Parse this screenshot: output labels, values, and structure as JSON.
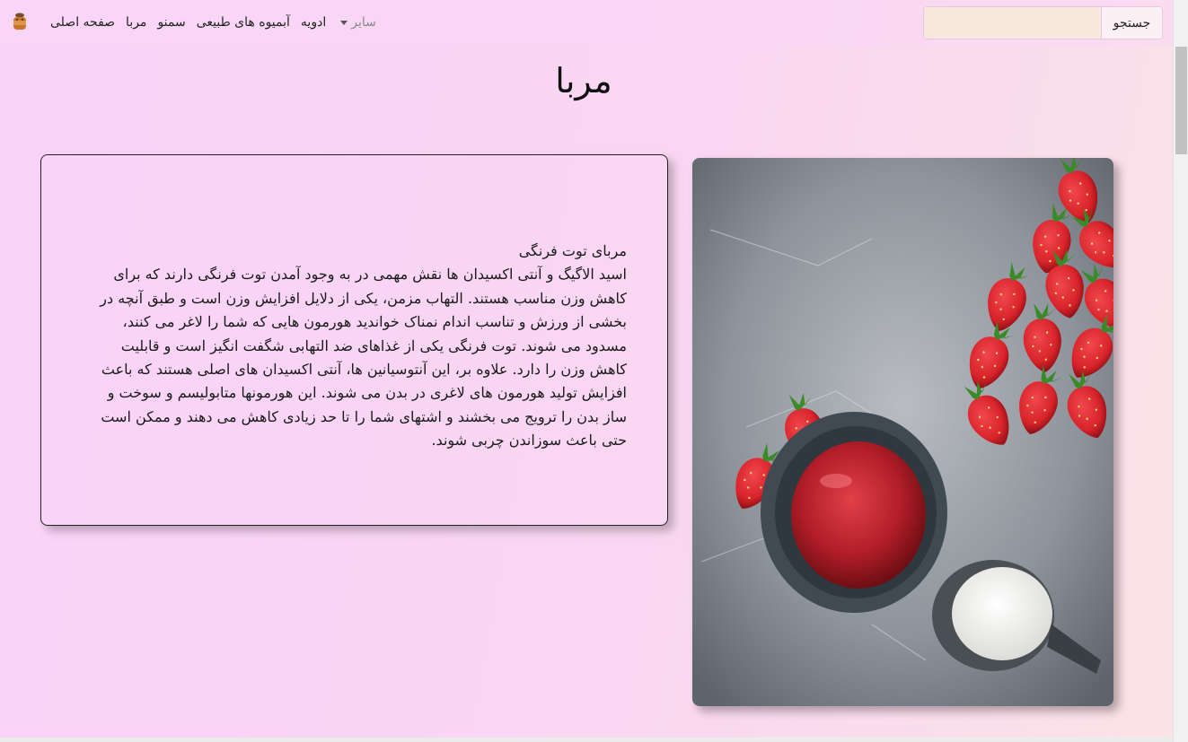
{
  "nav": {
    "logo_icon": "jam-jar-icon",
    "links": [
      {
        "label": "صفحه اصلی",
        "muted": false
      },
      {
        "label": "مربا",
        "muted": false
      },
      {
        "label": "سمنو",
        "muted": false
      },
      {
        "label": "آبمیوه های طبیعی",
        "muted": false
      },
      {
        "label": "ادویه",
        "muted": false
      }
    ],
    "dropdown_label": "سایر",
    "search": {
      "placeholder": "",
      "value": "",
      "button_label": "جستجو"
    }
  },
  "page": {
    "title": "مربا",
    "article": {
      "heading": "مربای توت فرنگی",
      "body": "اسید الاگیگ و آنتی اکسیدان ها نقش مهمی در به وجود آمدن توت فرنگی دارند که برای کاهش وزن مناسب هستند. التهاب مزمن، یکی از دلایل افزایش وزن است و طبق آنچه در بخشی از ورزش و تناسب اندام نمناک خواندید هورمون هایی که شما را لاغر می کنند، مسدود می شوند. توت فرنگی یکی از غذاهای ضد التهابی شگفت انگیز است و قابلیت کاهش وزن را دارد. علاوه بر، این آنتوسیانین ها، آنتی اکسیدان های اصلی هستند که باعث افزایش تولید هورمون های لاغری در بدن می شوند. این هورمونها متابولیسم و سوخت و ساز بدن را ترویج می بخشند و اشتهای شما را تا حد زیادی کاهش می دهند و ممکن است حتی باعث سوزاندن چربی شوند."
    },
    "image_icon": "strawberry-jam-photo"
  },
  "colors": {
    "background_start": "#f9d3f9",
    "background_end": "#fbe3e6",
    "search_input_bg": "#f8e7dc",
    "stone": "#8e949b",
    "jam": "#b31e28",
    "strawberry": "#d8232a",
    "leaf": "#3a8a2a",
    "milk": "#f4f4f2"
  }
}
